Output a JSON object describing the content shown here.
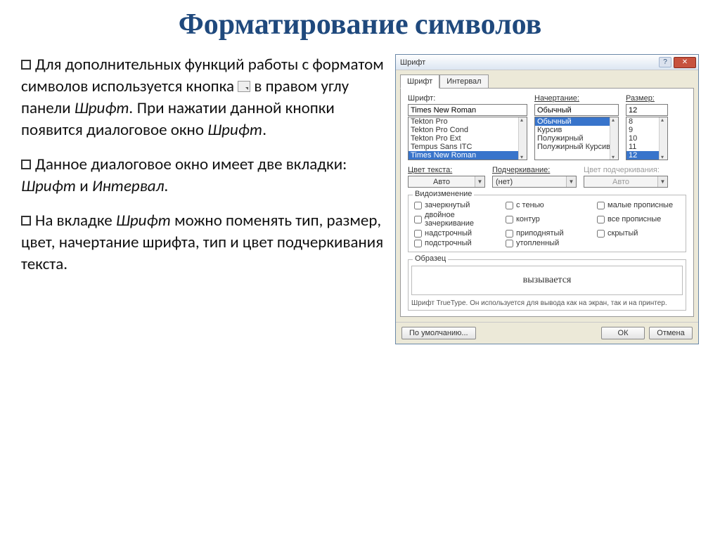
{
  "title": "Форматирование символов",
  "bullets": {
    "b1a": "Для дополнительных функций работы с форматом символов используется кнопка ",
    "b1b": " в правом углу панели ",
    "b1_panel": "Шрифт.",
    "b1c": " При нажатии данной кнопки появится диалоговое окно ",
    "b1_dialog": "Шрифт",
    "b2a": "Данное диалоговое окно имеет две вкладки: ",
    "b2_tab1": "Шрифт",
    "b2_and": " и ",
    "b2_tab2": "Интервал",
    "b3a": "На вкладке ",
    "b3_tab": "Шрифт",
    "b3b": " можно поменять тип, размер, цвет, начертание шрифта, тип и цвет подчеркивания текста."
  },
  "dialog": {
    "title": "Шрифт",
    "tabs": {
      "font": "Шрифт",
      "interval": "Интервал"
    },
    "labels": {
      "font": "Шрифт:",
      "style": "Начертание:",
      "size": "Размер:",
      "textcolor": "Цвет текста:",
      "underline": "Подчеркивание:",
      "ulcolor": "Цвет подчеркивания:",
      "effects": "Видоизменение",
      "sample": "Образец"
    },
    "font": {
      "value": "Times New Roman",
      "list": [
        "Tekton Pro",
        "Tekton Pro Cond",
        "Tekton Pro Ext",
        "Tempus Sans ITC",
        "Times New Roman"
      ]
    },
    "style": {
      "value": "Обычный",
      "list": [
        "Обычный",
        "Курсив",
        "Полужирный",
        "Полужирный Курсив"
      ]
    },
    "size": {
      "value": "12",
      "list": [
        "8",
        "9",
        "10",
        "11",
        "12"
      ]
    },
    "textcolor": "Авто",
    "underline": "(нет)",
    "ulcolor": "Авто",
    "checks": {
      "c1": "зачеркнутый",
      "c2": "с тенью",
      "c3": "малые прописные",
      "c4": "двойное зачеркивание",
      "c5": "контур",
      "c6": "все прописные",
      "c7": "надстрочный",
      "c8": "приподнятый",
      "c9": "скрытый",
      "c10": "подстрочный",
      "c11": "утопленный"
    },
    "sample": "вызывается",
    "hint": "Шрифт TrueType. Он используется для вывода как на экран, так и на принтер.",
    "buttons": {
      "default": "По умолчанию...",
      "ok": "ОК",
      "cancel": "Отмена"
    }
  }
}
